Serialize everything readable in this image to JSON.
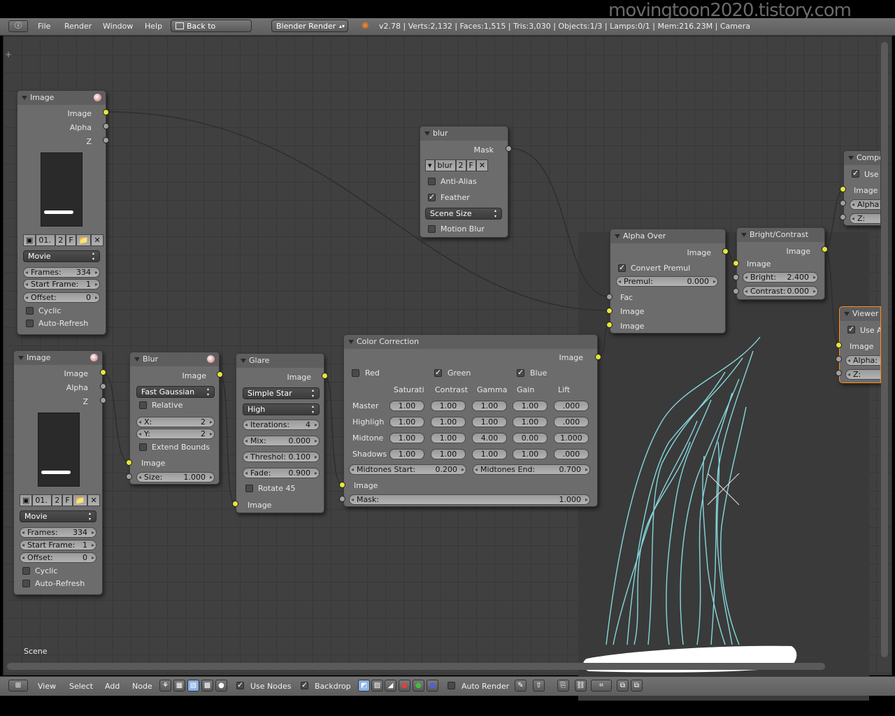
{
  "watermark": "movingtoon2020.tistory.com",
  "topbar": {
    "menus": [
      "File",
      "Render",
      "Window",
      "Help"
    ],
    "back_button": "Back to Previous",
    "render_engine": "Blender Render",
    "stats": "v2.78 | Verts:2,132 | Faces:1,515 | Tris:3,030 | Objects:1/3 | Lamps:0/1 | Mem:216.23M | Camera"
  },
  "scene_label": "Scene",
  "nodes": {
    "image1": {
      "title": "Image",
      "outputs": [
        "Image",
        "Alpha",
        "Z"
      ],
      "image_name": "01.",
      "users": "2",
      "fake": "F",
      "source": "Movie",
      "frames_label": "Frames:",
      "frames": "334",
      "start_label": "Start Frame:",
      "start": "1",
      "offset_label": "Offset:",
      "offset": "0",
      "cyclic": "Cyclic",
      "auto_refresh": "Auto-Refresh"
    },
    "image2": {
      "title": "Image",
      "outputs": [
        "Image",
        "Alpha",
        "Z"
      ],
      "image_name": "01.",
      "users": "2",
      "fake": "F",
      "source": "Movie",
      "frames_label": "Frames:",
      "frames": "334",
      "start_label": "Start Frame:",
      "start": "1",
      "offset_label": "Offset:",
      "offset": "0",
      "cyclic": "Cyclic",
      "auto_refresh": "Auto-Refresh"
    },
    "blur": {
      "title": "Blur",
      "output": "Image",
      "filter": "Fast Gaussian",
      "relative": "Relative",
      "x_label": "X:",
      "x": "2",
      "y_label": "Y:",
      "y": "2",
      "extend": "Extend Bounds",
      "input": "Image",
      "size_label": "Size:",
      "size": "1.000"
    },
    "mask": {
      "title": "blur",
      "output": "Mask",
      "mask_name": "blur",
      "users": "2",
      "fake": "F",
      "anti_alias": "Anti-Alias",
      "feather": "Feather",
      "size_mode": "Scene Size",
      "motion_blur": "Motion Blur"
    },
    "glare": {
      "title": "Glare",
      "output": "Image",
      "type": "Simple Star",
      "quality": "High",
      "iterations_label": "Iterations:",
      "iterations": "4",
      "mix_label": "Mix:",
      "mix": "0.000",
      "threshold_label": "Threshol:",
      "threshold": "0.100",
      "fade_label": "Fade:",
      "fade": "0.900",
      "rotate": "Rotate 45",
      "input": "Image"
    },
    "colorcorrection": {
      "title": "Color Correction",
      "output": "Image",
      "channels": [
        "Red",
        "Green",
        "Blue"
      ],
      "columns": [
        "Saturati",
        "Contrast",
        "Gamma",
        "Gain",
        "Lift"
      ],
      "rows": [
        {
          "name": "Master",
          "values": [
            "1.00",
            "1.00",
            "1.00",
            "1.00",
            ".000"
          ]
        },
        {
          "name": "Highligh",
          "values": [
            "1.00",
            "1.00",
            "1.00",
            "1.00",
            ".000"
          ]
        },
        {
          "name": "Midtone",
          "values": [
            "1.00",
            "1.00",
            "4.00",
            "0.00",
            "1.000"
          ]
        },
        {
          "name": "Shadows",
          "values": [
            "1.00",
            "1.00",
            "1.00",
            "1.00",
            ".000"
          ]
        }
      ],
      "mid_start_label": "Midtones Start:",
      "mid_start": "0.200",
      "mid_end_label": "Midtones End:",
      "mid_end": "0.700",
      "input": "Image",
      "mask_label": "Mask:",
      "mask": "1.000"
    },
    "alphaover": {
      "title": "Alpha Over",
      "output": "Image",
      "convert_premul": "Convert Premul",
      "premul_label": "Premul:",
      "premul": "0.000",
      "inputs": [
        "Fac",
        "Image",
        "Image"
      ]
    },
    "brightcontrast": {
      "title": "Bright/Contrast",
      "output": "Image",
      "input": "Image",
      "bright_label": "Bright:",
      "bright": "2.400",
      "contrast_label": "Contrast:",
      "contrast": "0.000"
    },
    "composite": {
      "title": "Compo",
      "use_alpha": "Use",
      "inputs": [
        "Image",
        "Alpha:",
        "Z:"
      ]
    },
    "viewer": {
      "title": "Viewer",
      "use_alpha": "Use A",
      "inputs": [
        "Image",
        "Alpha:",
        "Z:"
      ]
    }
  },
  "bottombar": {
    "menus": [
      "View",
      "Select",
      "Add",
      "Node"
    ],
    "use_nodes": "Use Nodes",
    "backdrop": "Backdrop",
    "auto_render": "Auto Render"
  }
}
